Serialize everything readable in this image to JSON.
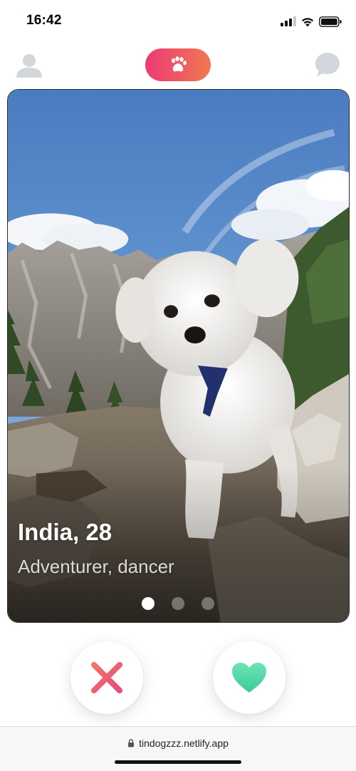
{
  "status_bar": {
    "time": "16:42",
    "icons": [
      "cellular-signal-icon",
      "wifi-icon",
      "battery-icon"
    ]
  },
  "nav": {
    "left_icon": "user-profile-icon",
    "center_icon": "paw-icon",
    "right_icon": "chat-bubble-icon",
    "center_gradient": [
      "#ec3b74",
      "#f0794f"
    ]
  },
  "profile_card": {
    "name_age": "India, 28",
    "bio": "Adventurer, dancer",
    "photo_count": 3,
    "active_photo": 1
  },
  "actions": {
    "nope_icon": "x-icon",
    "like_icon": "heart-icon",
    "nope_colors": [
      "#f0756a",
      "#e74b7a"
    ],
    "like_colors": [
      "#6ae6b4",
      "#3fc89a"
    ]
  },
  "browser": {
    "url": "tindogzzz.netlify.app"
  }
}
